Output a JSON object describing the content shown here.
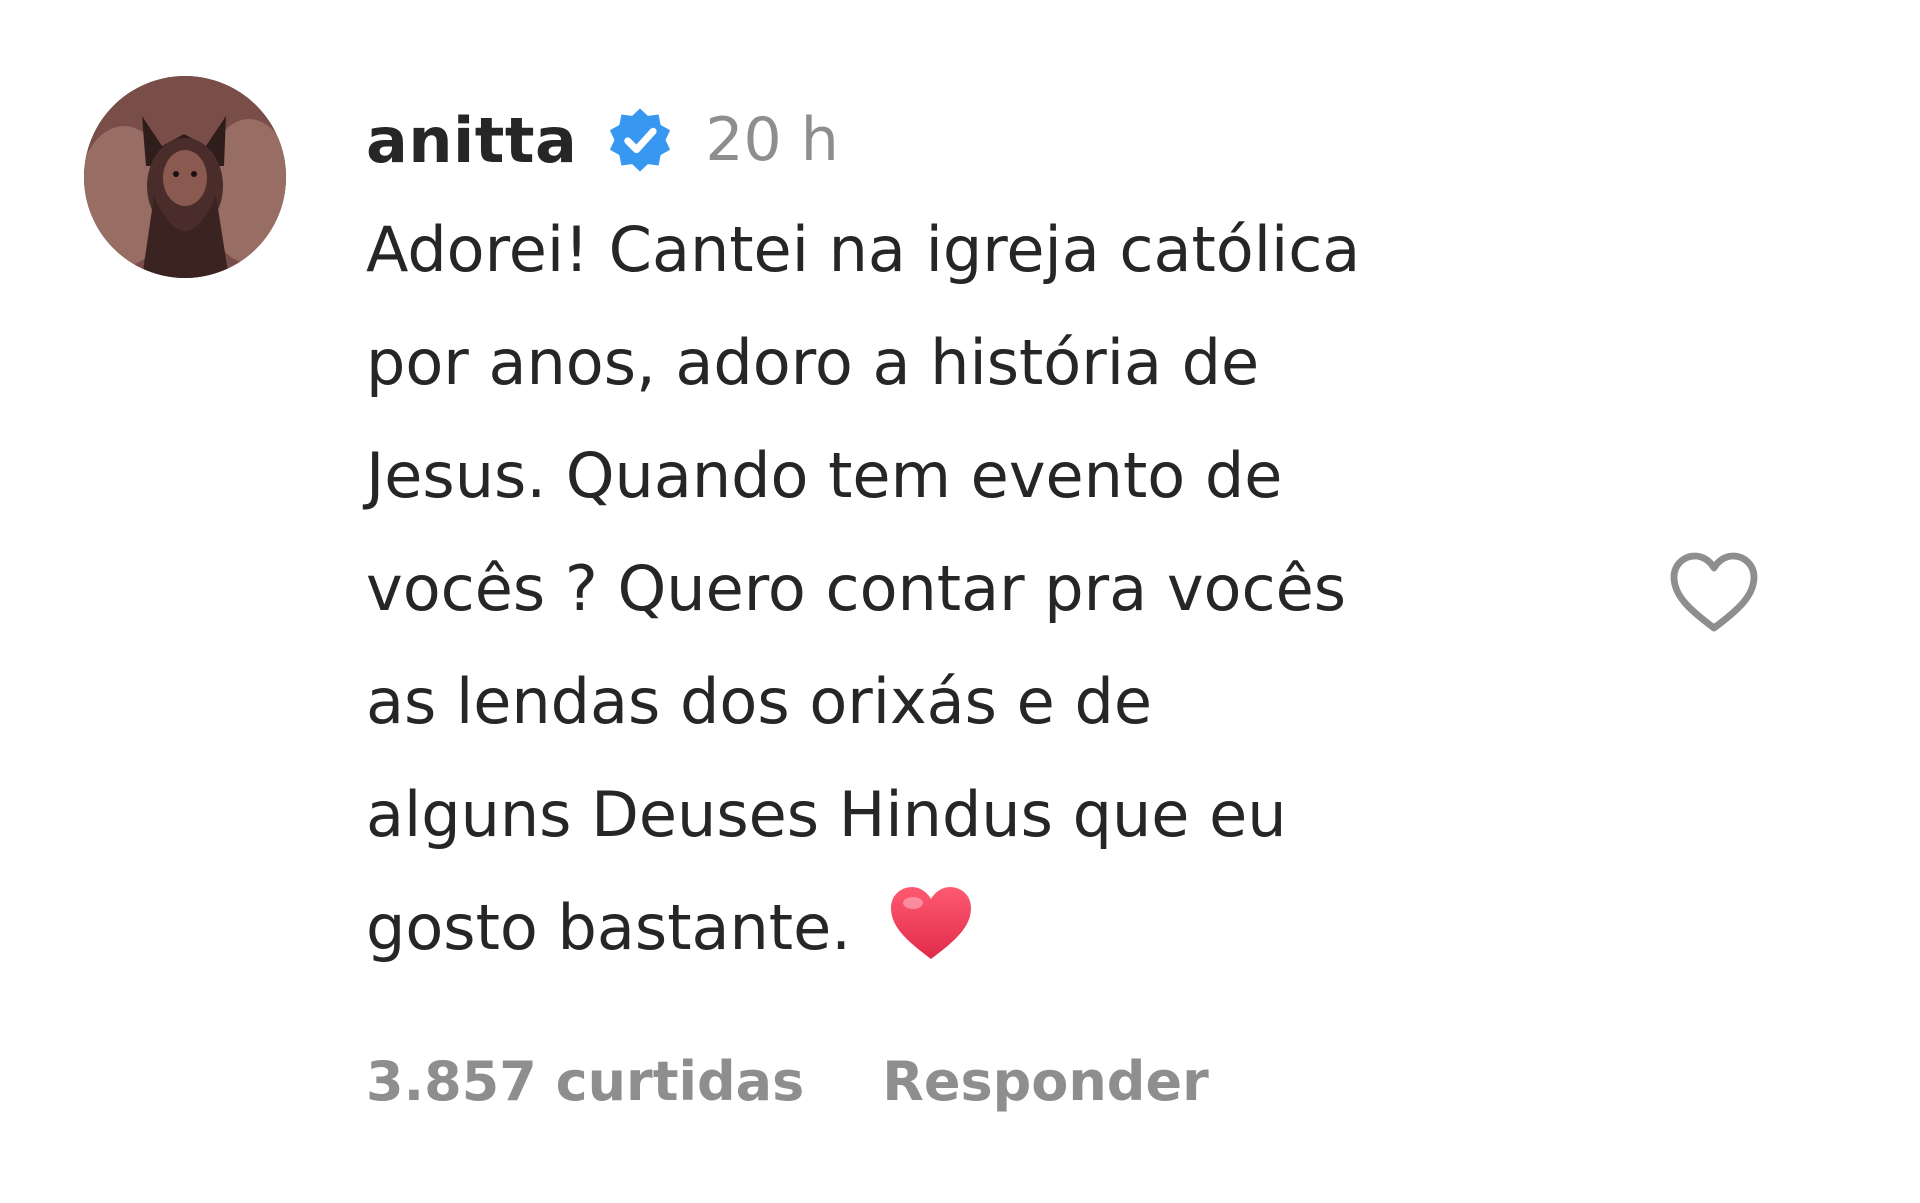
{
  "comment": {
    "username": "anitta",
    "verified_icon": "verified-badge-icon",
    "time_ago": "20 h",
    "text_lines": [
      "Adorei! Cantei na igreja católica",
      "por anos, adoro a história de",
      "Jesus. Quando tem evento de",
      "vocês ? Quero contar pra vocês",
      "as lendas dos orixás e de",
      "alguns Deuses Hindus que eu",
      "gosto bastante."
    ],
    "emoji": "red-heart-emoji",
    "likes": "3.857 curtidas",
    "reply_label": "Responder",
    "like_icon": "heart-outline-icon"
  },
  "colors": {
    "text": "#262626",
    "muted": "#8e8e8e",
    "verified": "#3897f0",
    "heart": "#ed3b55"
  }
}
